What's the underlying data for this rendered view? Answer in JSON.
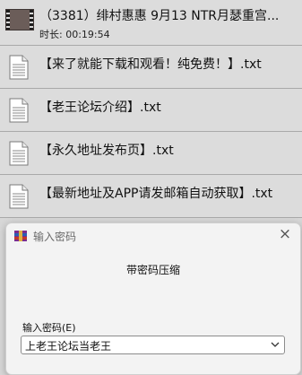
{
  "video": {
    "title": "（3381）绯村惠惠 9月13 NTR月瑟重宫...",
    "duration": "时长: 00:19:54"
  },
  "files": [
    {
      "name": "【来了就能下载和观看！纯免费！】.txt",
      "icon": "document-icon"
    },
    {
      "name": "【老王论坛介绍】.txt",
      "icon": "document-icon"
    },
    {
      "name": "【永久地址发布页】.txt",
      "icon": "document-icon"
    },
    {
      "name": "【最新地址及APP请发邮箱自动获取】.txt",
      "icon": "document-icon"
    }
  ],
  "dialog": {
    "title": "输入密码",
    "icon": "winrar-icon",
    "close": "×",
    "message": "带密码压缩",
    "password_label": "输入密码(E)",
    "password_value": "上老王论坛当老王"
  }
}
